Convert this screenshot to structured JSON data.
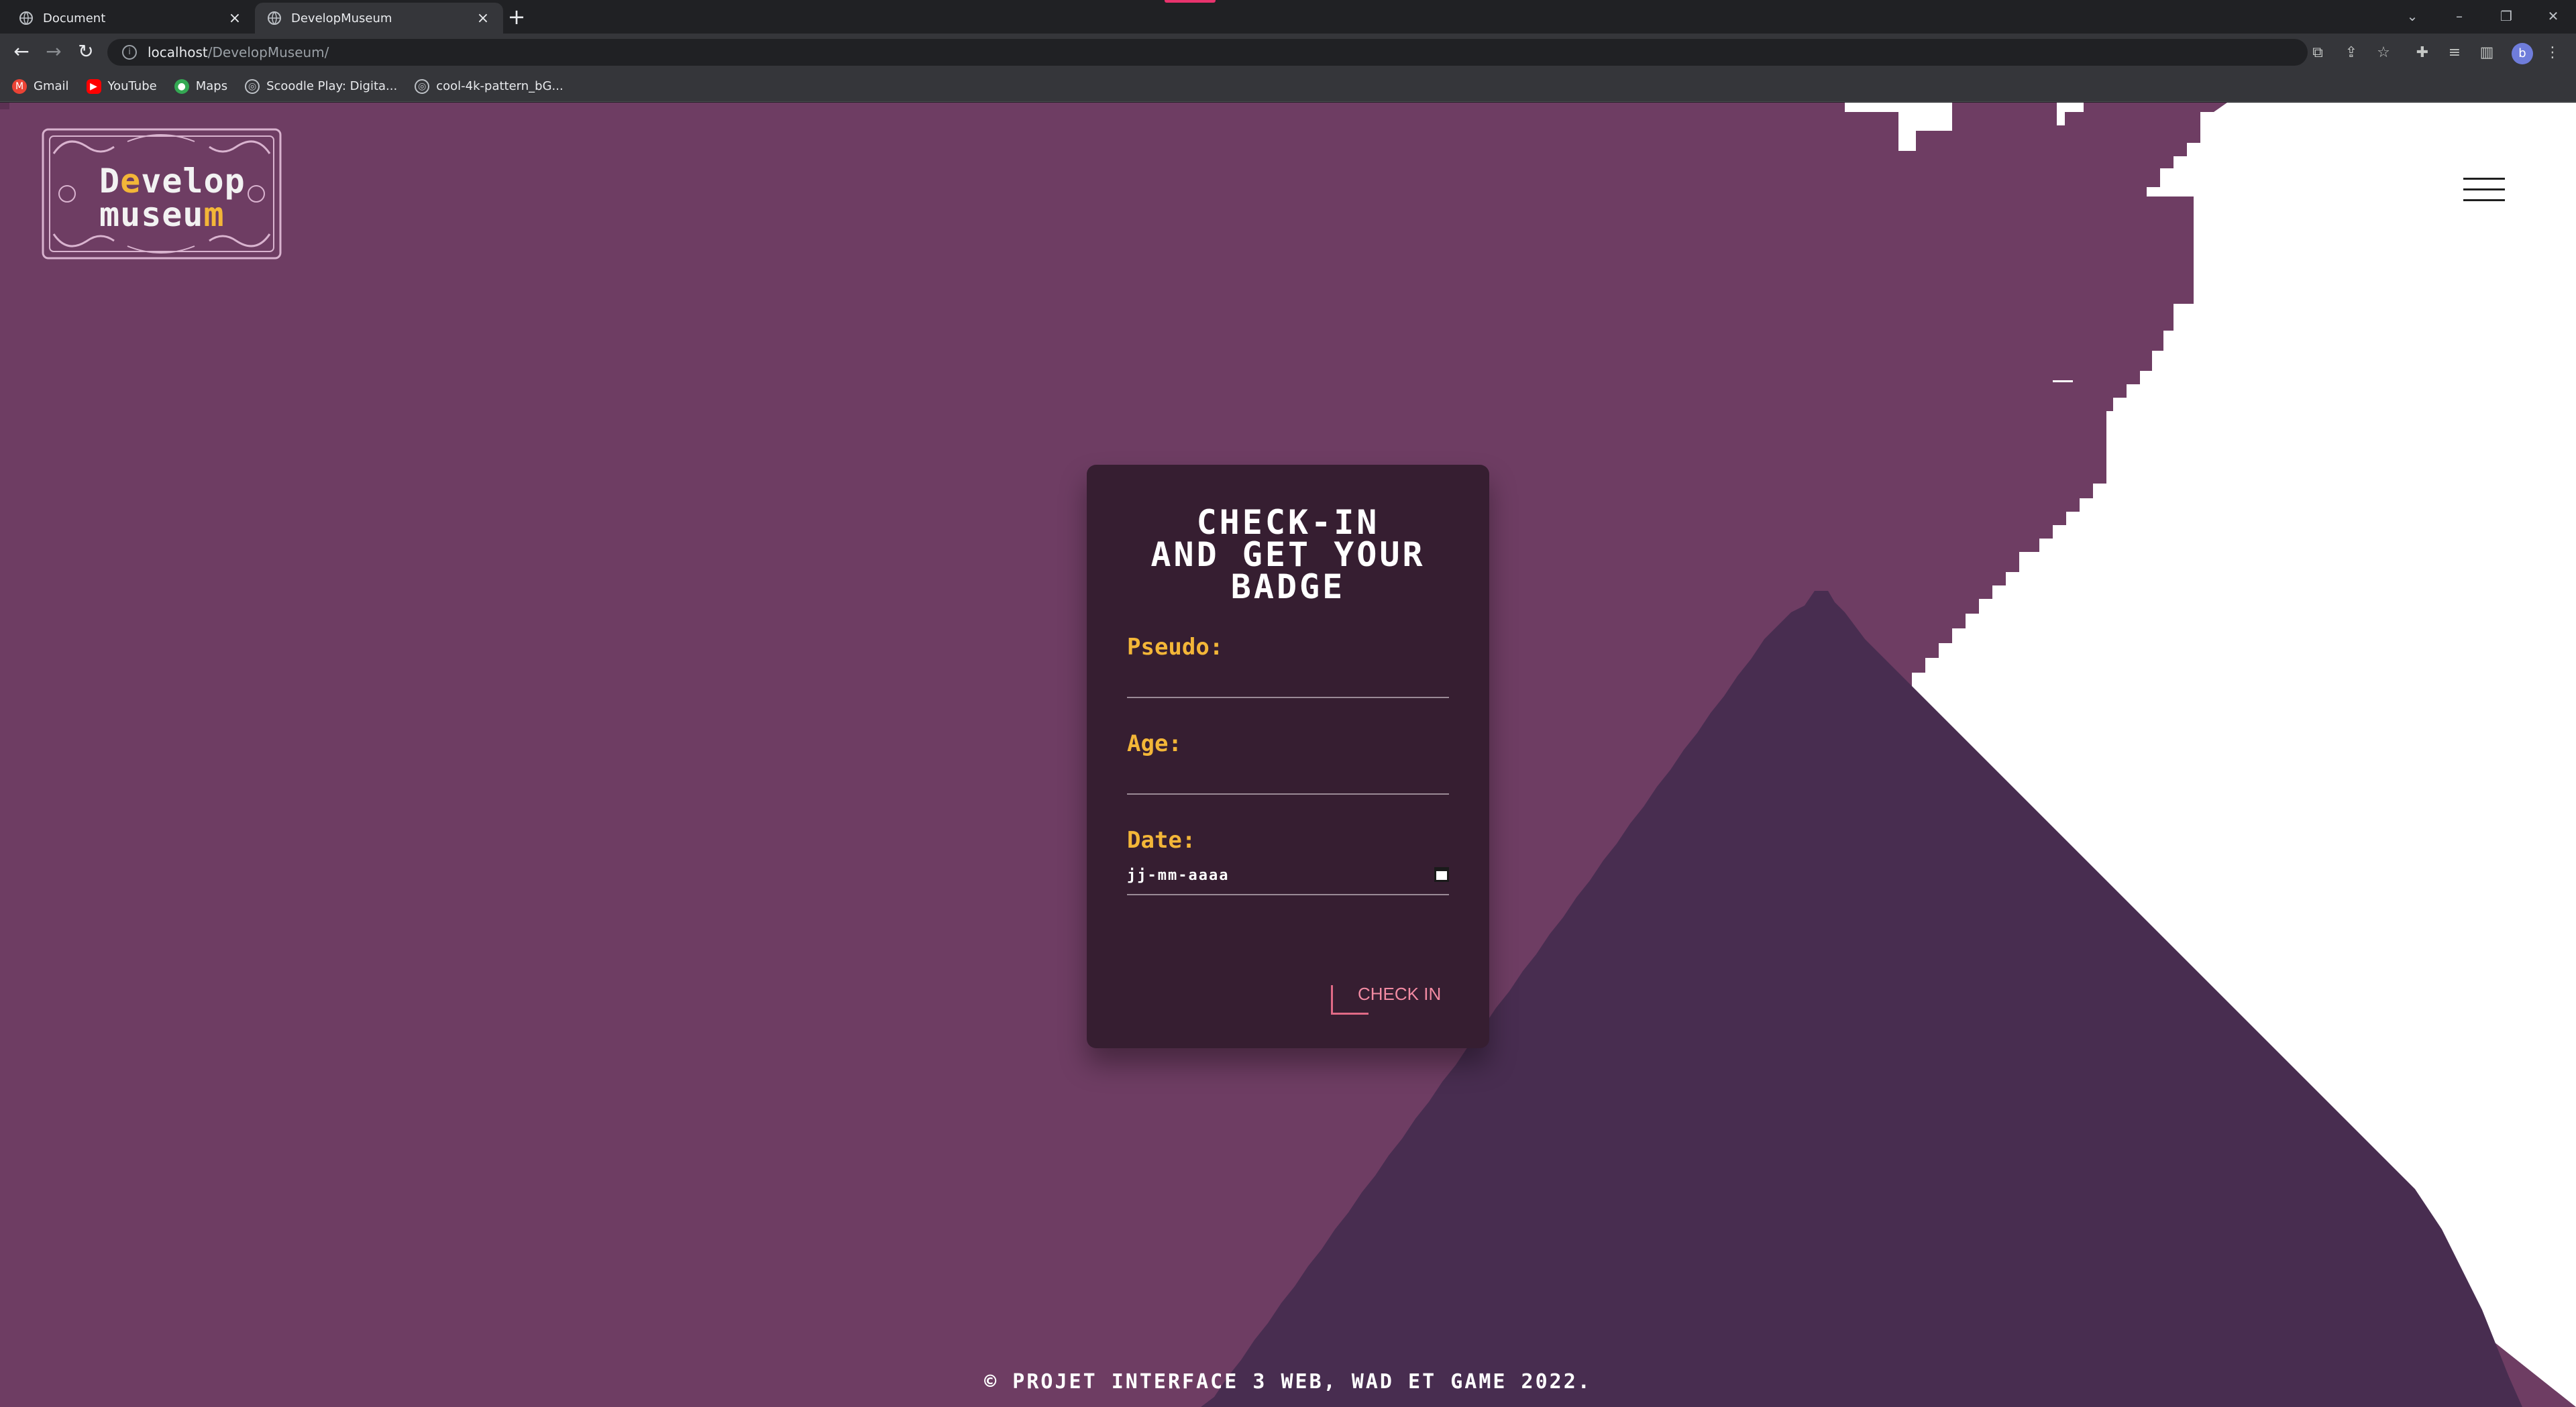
{
  "browser": {
    "tabs": [
      {
        "title": "Document",
        "active": false
      },
      {
        "title": "DevelopMuseum",
        "active": true
      }
    ],
    "new_tab_glyph": "+",
    "address": {
      "host": "localhost",
      "path": "/DevelopMuseum/"
    },
    "bookmarks": [
      {
        "label": "Gmail",
        "icon": "gmail-icon",
        "color": "#ea4335"
      },
      {
        "label": "YouTube",
        "icon": "youtube-icon",
        "color": "#ff0000"
      },
      {
        "label": "Maps",
        "icon": "maps-icon",
        "color": "#34a853"
      },
      {
        "label": "Scoodle Play: Digita...",
        "icon": "globe-icon",
        "color": "#9aa0a6"
      },
      {
        "label": "cool-4k-pattern_bG...",
        "icon": "globe-icon",
        "color": "#9aa0a6"
      }
    ],
    "profile_initial": "b"
  },
  "site": {
    "logo": {
      "line1_a": "D",
      "line1_accent": "e",
      "line1_b": "velop",
      "line2_a": "museu",
      "line2_accent": "m"
    },
    "form": {
      "title_line1": "Check-in",
      "title_line2": "and get your",
      "title_line3": "Badge",
      "pseudo_label": "Pseudo:",
      "age_label": "Age:",
      "date_label": "Date:",
      "date_placeholder": "jj-mm-aaaa",
      "submit_label": "CHECK IN"
    },
    "footer": "© Projet Interface 3 WEB, WAD et GAME 2022."
  },
  "colors": {
    "page_bg": "#6e3d63",
    "mountain": "#482d50",
    "sky": "#ffffff",
    "card": "#361e31",
    "accent": "#f3b638",
    "button": "#f28aa2"
  }
}
